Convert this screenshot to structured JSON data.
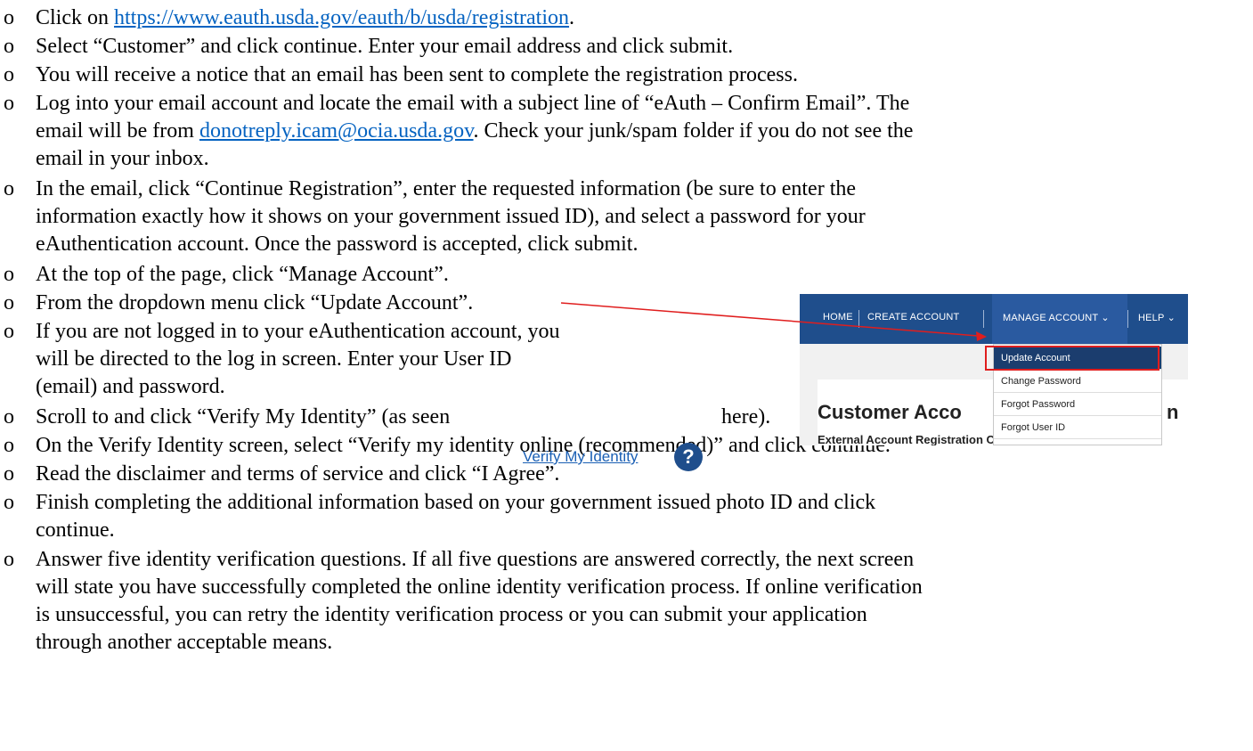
{
  "bullet_symbol": "o",
  "steps": [
    {
      "before": "Click on ",
      "link": "https://www.eauth.usda.gov/eauth/b/usda/registration",
      "after": "."
    },
    {
      "text": "Select “Customer” and click continue.  Enter your email address and click submit."
    },
    {
      "text": "You will receive a notice that an email has been sent to complete the registration process."
    },
    {
      "line1": "Log into your email account and locate the email with a subject line of “eAuth – Confirm Email”.  The",
      "line2_before": "email will be from ",
      "line2_link": "donotreply.icam@ocia.usda.gov",
      "line2_after": ".  Check your junk/spam folder if you do not see the",
      "line3": "email in your inbox."
    },
    {
      "line1": "In the email, click “Continue Registration”, enter the requested information (be sure to enter the",
      "line2": "information exactly how it shows on your government issued ID), and select a password for your",
      "line3": "eAuthentication account.  Once the password is accepted, click submit."
    },
    {
      "text": "At the top of the page, click “Manage Account”."
    },
    {
      "text": "From the dropdown menu click “Update Account”."
    },
    {
      "line1": "If you are not logged in to your eAuthentication account, you",
      "line2": "will be directed to the log in screen.  Enter your User ID",
      "line3": "(email) and password."
    },
    {
      "before": "Scroll to and click “Verify My Identity” (as seen",
      "after": "here)."
    },
    {
      "text": "On the Verify Identity screen, select “Verify my identity online (recommended)” and click continue."
    },
    {
      "text": "Read the disclaimer and terms of service and click “I Agree”."
    },
    {
      "line1": "Finish completing the additional information based on your government issued photo ID and click",
      "line2": "continue."
    },
    {
      "line1": "Answer five identity verification questions.  If all five questions are answered correctly, the next screen",
      "line2": "will state you have successfully completed the online identity verification process.  If online verification",
      "line3": "is unsuccessful, you can retry the identity verification process or you can submit your application",
      "line4": "through another acceptable means."
    }
  ],
  "screenshot": {
    "nav": {
      "home": "HOME",
      "create_account": "CREATE ACCOUNT",
      "manage_account": "MANAGE ACCOUNT ⌄",
      "help": "HELP ⌄",
      "bg_color": "#1f4e8c"
    },
    "dropdown": [
      "Update Account",
      "Change Password",
      "Forgot Password",
      "Forgot User ID"
    ],
    "card_title": "Customer Acco",
    "card_title_tail": "n",
    "card_subtitle": "External Account Registration Complete",
    "highlight_color": "#e01e1e"
  },
  "verify_link": {
    "label": "Verify My Identity",
    "help_icon": "?"
  },
  "colors": {
    "link": "#0563c1",
    "text": "#000000"
  }
}
